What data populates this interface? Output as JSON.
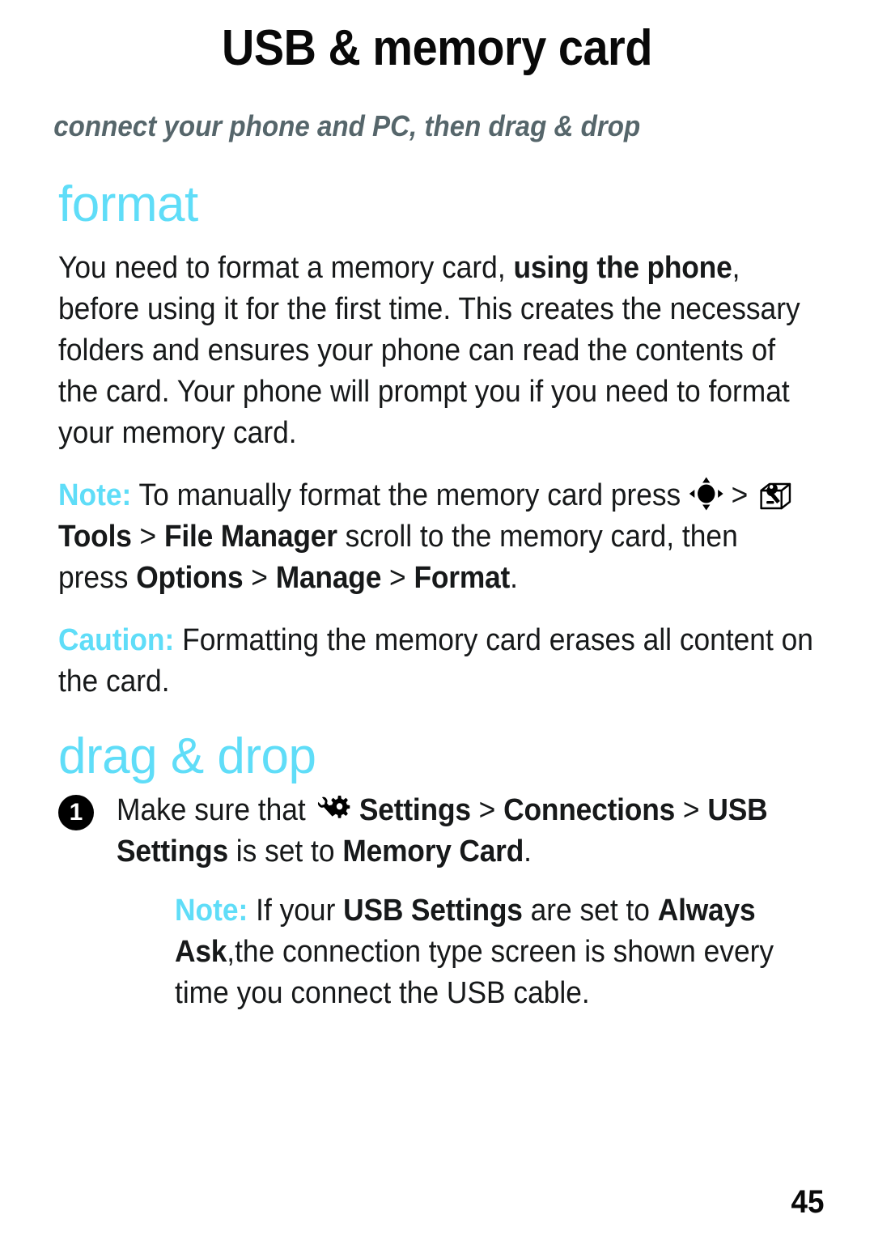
{
  "header": {
    "title": "USB & memory card",
    "subtitle": "connect your phone and PC, then drag & drop"
  },
  "sections": [
    {
      "heading": "format",
      "paragraphs": [
        {
          "kind": "body",
          "runs": [
            {
              "text": "You need to format a memory card, ",
              "style": "normal"
            },
            {
              "text": "using the phone",
              "style": "bold"
            },
            {
              "text": ", before using it for the first time. This creates the necessary folders and ensures your phone can read the contents of the card. Your phone will prompt you if you need to format your memory card.",
              "style": "normal"
            }
          ]
        },
        {
          "kind": "note",
          "runs": [
            {
              "text": "Note:",
              "style": "cyan"
            },
            {
              "text": " To manually format the memory card press ",
              "style": "normal"
            },
            {
              "icon": "nav-key-icon"
            },
            {
              "text": " > ",
              "style": "normal"
            },
            {
              "icon": "tools-icon"
            },
            {
              "text": " ",
              "style": "normal"
            },
            {
              "text": "Tools",
              "style": "bold"
            },
            {
              "text": " > ",
              "style": "normal"
            },
            {
              "text": "File Manager",
              "style": "bold"
            },
            {
              "text": " scroll to the memory card, then press ",
              "style": "normal"
            },
            {
              "text": "Options",
              "style": "bold"
            },
            {
              "text": " > ",
              "style": "normal"
            },
            {
              "text": "Manage",
              "style": "bold"
            },
            {
              "text": " > ",
              "style": "normal"
            },
            {
              "text": "Format",
              "style": "bold"
            },
            {
              "text": ".",
              "style": "normal"
            }
          ]
        },
        {
          "kind": "caution",
          "runs": [
            {
              "text": "Caution:",
              "style": "cyan"
            },
            {
              "text": " Formatting the memory card erases all content on the card.",
              "style": "normal"
            }
          ]
        }
      ]
    },
    {
      "heading": "drag & drop",
      "steps": [
        {
          "number": "1",
          "runs": [
            {
              "text": "Make sure that ",
              "style": "normal"
            },
            {
              "icon": "settings-gear-icon"
            },
            {
              "text": " ",
              "style": "normal"
            },
            {
              "text": "Settings",
              "style": "bold"
            },
            {
              "text": " > ",
              "style": "normal"
            },
            {
              "text": "Connections",
              "style": "bold"
            },
            {
              "text": " > ",
              "style": "normal"
            },
            {
              "text": "USB Settings",
              "style": "bold"
            },
            {
              "text": " is set to ",
              "style": "normal"
            },
            {
              "text": "Memory Card",
              "style": "bold"
            },
            {
              "text": ".",
              "style": "normal"
            }
          ],
          "sub_note": {
            "runs": [
              {
                "text": "Note:",
                "style": "cyan"
              },
              {
                "text": " If your ",
                "style": "normal"
              },
              {
                "text": "USB Settings",
                "style": "bold"
              },
              {
                "text": " are set to ",
                "style": "normal"
              },
              {
                "text": "Always Ask",
                "style": "bold"
              },
              {
                "text": ",the connection type screen is shown every time you connect the USB cable.",
                "style": "normal"
              }
            ]
          }
        }
      ]
    }
  ],
  "footer": {
    "page_number": "45"
  },
  "colors": {
    "accent_cyan": "#5fddf8",
    "subtitle_gray": "#56666b",
    "text_black": "#17191a",
    "title_black": "#090909"
  },
  "icons": {
    "nav-key-icon": "5-way navigation key",
    "tools-icon": "Tools toolbox",
    "settings-gear-icon": "Settings gear and wrench"
  }
}
